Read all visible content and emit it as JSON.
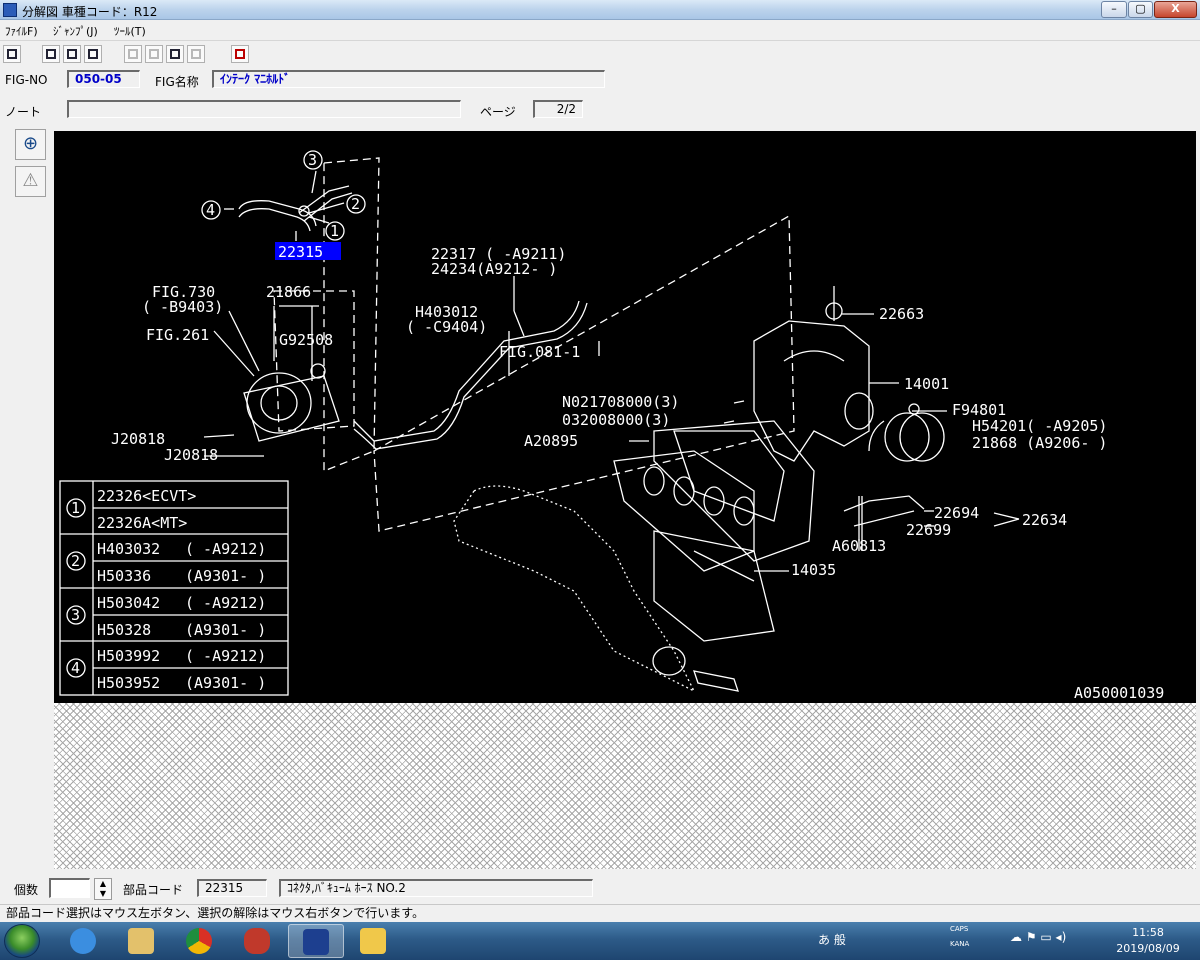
{
  "window": {
    "title": "分解図 車種コード：R12",
    "min_label": "–",
    "max_label": "▢",
    "close_label": "X"
  },
  "menu": {
    "file": "ﾌｧｲﾙF)",
    "jump": "ｼﾞｬﾝﾌﾟ(J)",
    "tool": "ﾂｰﾙ(T)"
  },
  "fig": {
    "no_label": "FIG-NO",
    "no_value": "050-05",
    "name_label": "FIG名称",
    "name_value": "ｲﾝﾃｰｸ ﾏﾆﾎﾙﾄﾞ",
    "note_label": "ノート",
    "note_value": "",
    "page_label": "ページ",
    "page_value": "2/2"
  },
  "side_tools": {
    "zoom_icon": "magnify-icon",
    "warning_icon": "warning-icon"
  },
  "diagram": {
    "code": "A050001039",
    "selected_part": "22315",
    "callouts": {
      "c3": "3",
      "c4": "4",
      "c2": "2",
      "c1": "1",
      "p22317": "22317 ( -A9211)",
      "p24234": "24234(A9212- )",
      "fig730": "FIG.730",
      "b9403": "( -B9403)",
      "p21866": "21866",
      "fig261": "FIG.261",
      "g92508": "G92508",
      "h403012": "H403012",
      "c9404": "( -C9404)",
      "fig081": "FIG.081-1",
      "p22663": "22663",
      "p14001": "14001",
      "n021708": "N021708000(3)",
      "p032008": "032008000(3)",
      "f94801": "F94801",
      "h54201": "H54201( -A9205)",
      "p21868": "21868 (A9206- )",
      "a20895": "A20895",
      "j20818a": "J20818",
      "j20818b": "J20818",
      "p22694": "22694",
      "p22634": "22634",
      "p22699": "22699",
      "a60813": "A60813",
      "p14035": "14035"
    },
    "legend": [
      {
        "num": "1",
        "rows": [
          [
            "22326<ECVT>",
            ""
          ],
          [
            "22326A<MT>",
            ""
          ]
        ]
      },
      {
        "num": "2",
        "rows": [
          [
            "H403032",
            "( -A9212)"
          ],
          [
            "H50336",
            "(A9301- )"
          ]
        ]
      },
      {
        "num": "3",
        "rows": [
          [
            "H503042",
            "( -A9212)"
          ],
          [
            "H50328",
            "(A9301- )"
          ]
        ]
      },
      {
        "num": "4",
        "rows": [
          [
            "H503992",
            "( -A9212)"
          ],
          [
            "H503952",
            "(A9301- )"
          ]
        ]
      }
    ]
  },
  "bottom": {
    "qty_label": "個数",
    "qty_value": "",
    "part_code_label": "部品コード",
    "part_code_value": "22315",
    "part_name_value": "ｺﾈｸﾀ,ﾊﾞｷｭｰﾑ ﾎｰｽ NO.2"
  },
  "status": "部品コード選択はマウス左ボタン、選択の解除はマウス右ボタンで行います。",
  "taskbar": {
    "apps": [
      "ie-icon",
      "explorer-icon",
      "chrome-icon",
      "game-icon",
      "subaru-parts-icon",
      "folder-icon"
    ],
    "ime": "あ 般",
    "clock_time": "11:58",
    "clock_date": "2019/08/09",
    "caps": "CAPS",
    "kana": "KANA"
  },
  "colors": {
    "diagram_bg": "#000000",
    "selected_bg": "#0000ff",
    "field_blue": "#0000c8"
  }
}
